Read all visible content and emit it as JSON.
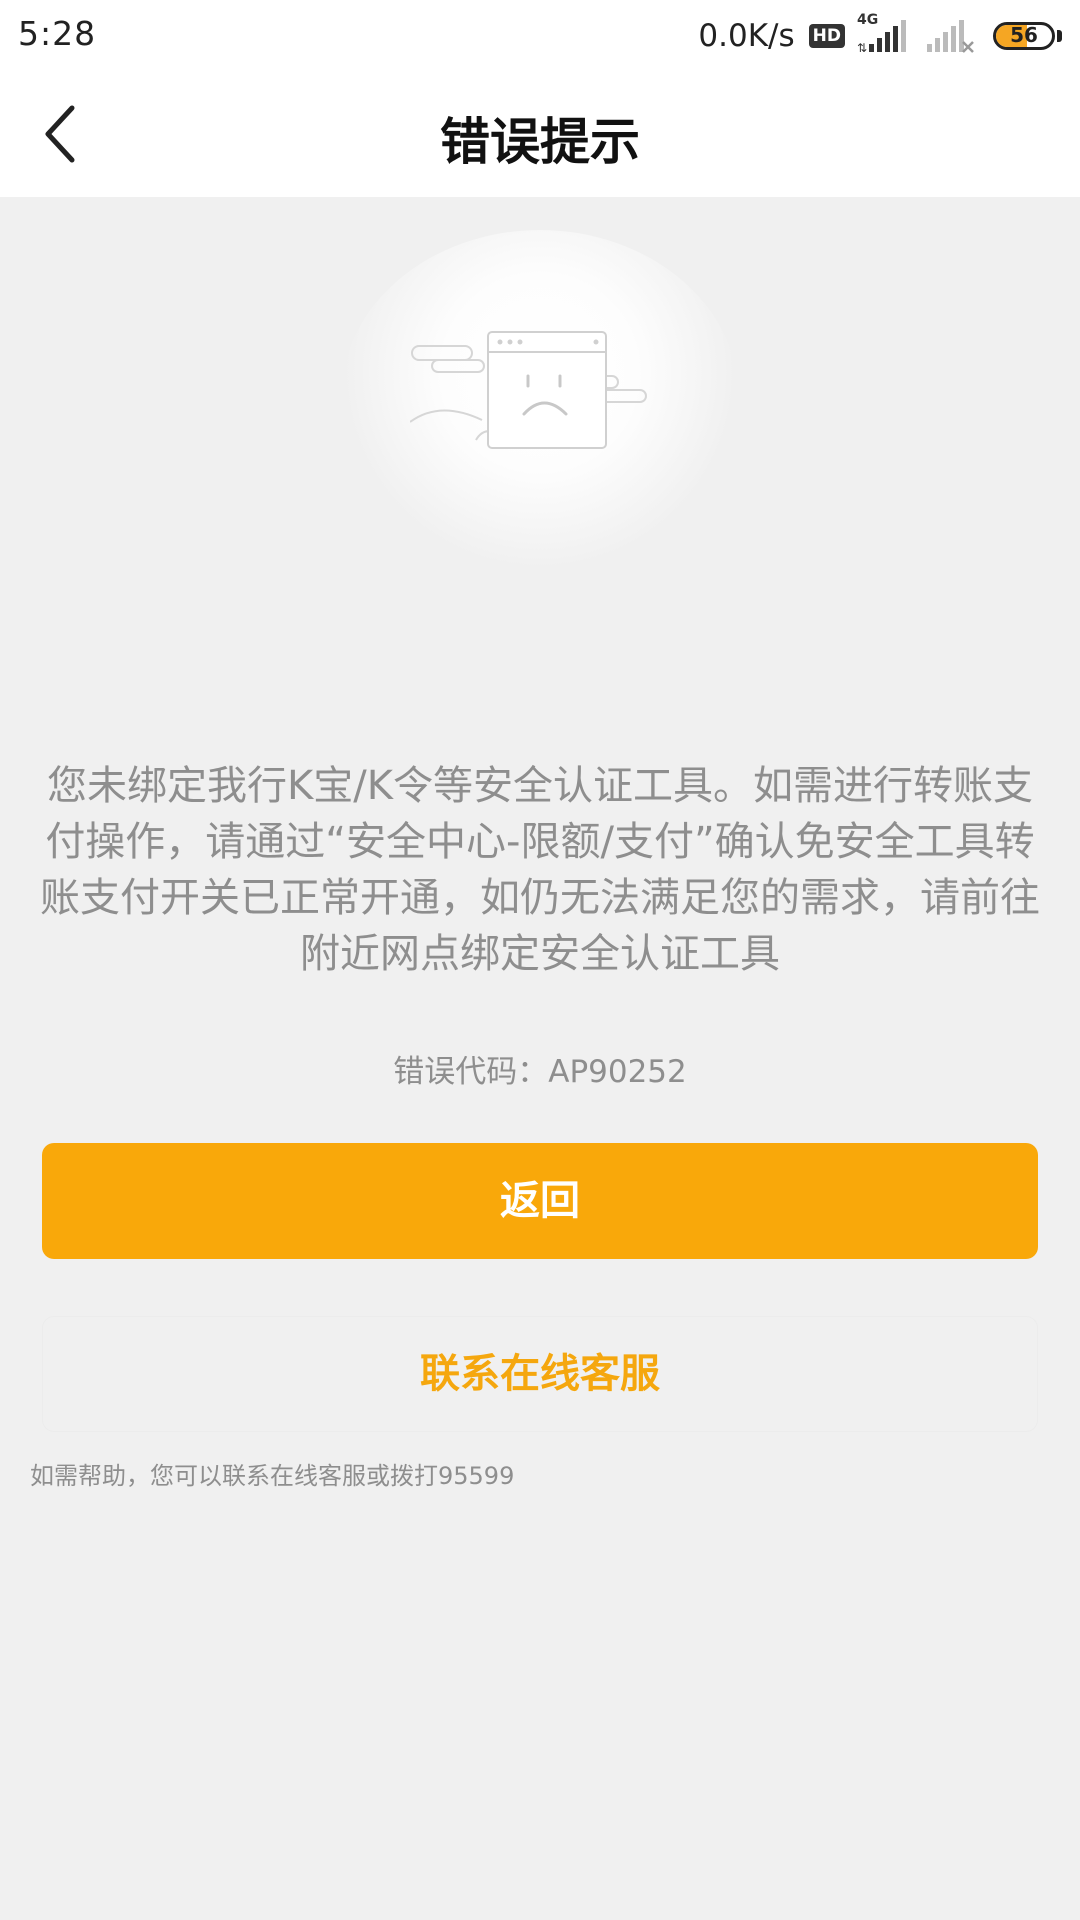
{
  "status_bar": {
    "time": "5:28",
    "net_speed": "0.0K/s",
    "hd_badge": "HD",
    "network_type": "4G",
    "battery_level": "56"
  },
  "header": {
    "title": "错误提示",
    "back_icon": "chevron-left-icon"
  },
  "illustration": {
    "icon": "sad-browser-window-icon"
  },
  "main": {
    "message": "您未绑定我行K宝/K令等安全认证工具。如需进行转账支付操作，请通过“安全中心-限额/支付”确认免安全工具转账支付开关已正常开通，如仍无法满足您的需求，请前往附近网点绑定安全认证工具",
    "error_code_label": "错误代码：",
    "error_code": "AP90252"
  },
  "actions": {
    "return_label": "返回",
    "service_label": "联系在线客服"
  },
  "help_text": "如需帮助，您可以联系在线客服或拨打95599",
  "colors": {
    "accent": "#f9a80a",
    "service_text": "#f5a70e",
    "background": "#f0f0f0",
    "muted_text": "#8e8e8e"
  }
}
